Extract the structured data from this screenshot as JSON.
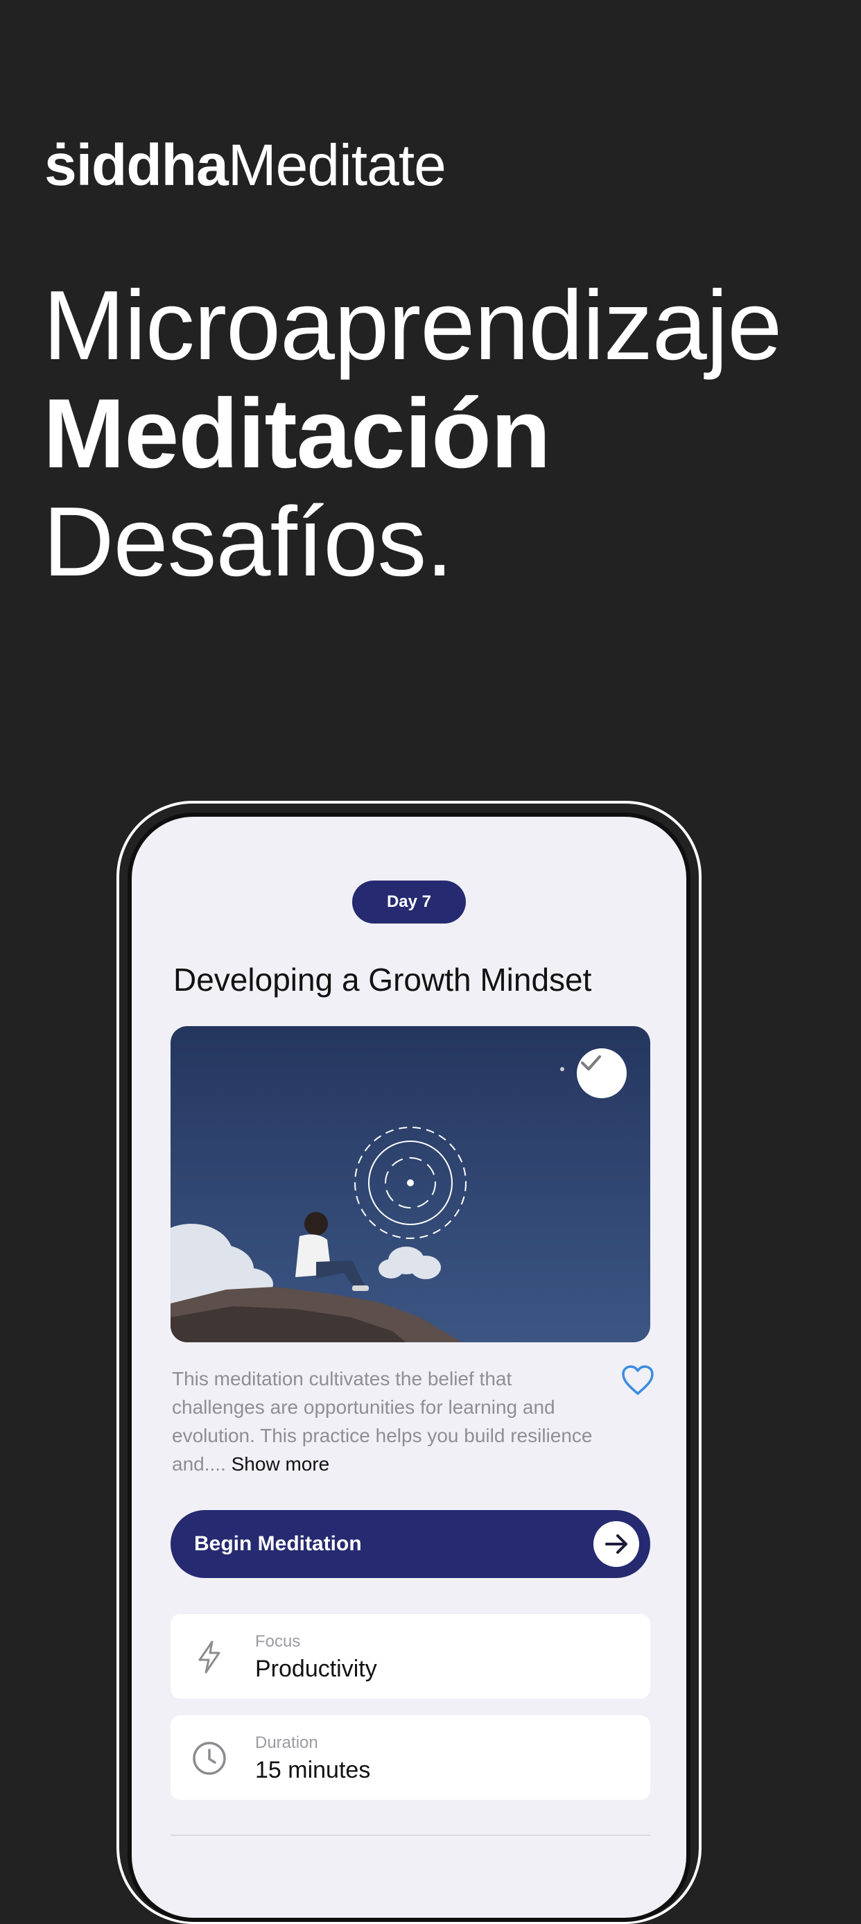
{
  "brand": {
    "part1": "ṡiddha",
    "part2": "Meditate"
  },
  "headline": {
    "line1": "Microaprendizaje",
    "line2": "Meditación",
    "line3": "Desafíos."
  },
  "screen": {
    "day_label": "Day 7",
    "title": "Developing a Growth Mindset",
    "hero_image_icon": "breathing-circles-icon",
    "completed_icon": "check-icon",
    "description": "This meditation cultivates the belief that challenges are opportunities for learning and evolution. This practice helps you build resilience and....",
    "show_more": "Show more",
    "favorite_icon": "heart-icon",
    "begin_button": "Begin Meditation",
    "begin_icon": "arrow-right-icon",
    "focus": {
      "label": "Focus",
      "value": "Productivity",
      "icon": "lightning-icon"
    },
    "duration": {
      "label": "Duration",
      "value": "15 minutes",
      "icon": "clock-icon"
    }
  },
  "colors": {
    "background": "#222223",
    "accent": "#262a70",
    "screen_bg": "#f1f0f6",
    "heart": "#3a8de0"
  }
}
